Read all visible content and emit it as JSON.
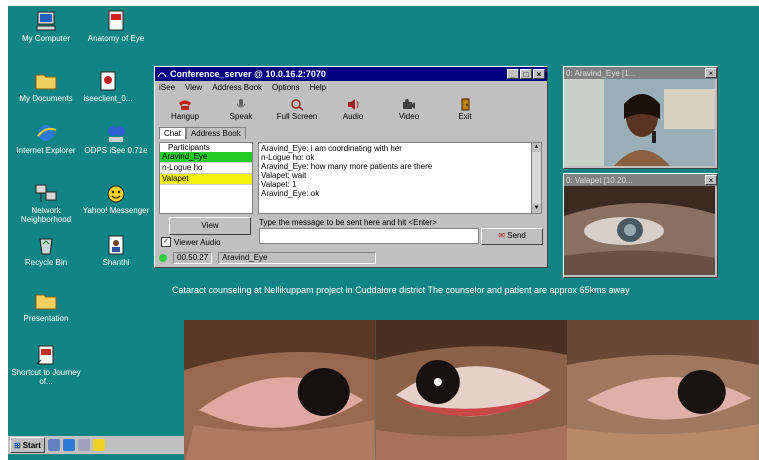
{
  "desktop_icons": [
    {
      "label": "My Computer",
      "icon": "computer-icon"
    },
    {
      "label": "Anatomy of Eye",
      "icon": "document-icon"
    },
    {
      "label": "My Documents",
      "icon": "folder-icon"
    },
    {
      "label": "iseeclient_0...",
      "icon": "program-icon"
    },
    {
      "label": "Internet Explorer",
      "icon": "internet-explorer-icon"
    },
    {
      "label": "ODPS iSee 0.71e",
      "icon": "isee-icon"
    },
    {
      "label": "Network Neighborhood",
      "icon": "network-icon"
    },
    {
      "label": "Yahoo! Messenger",
      "icon": "yahoo-messenger-icon"
    },
    {
      "label": "Recycle Bin",
      "icon": "recycle-bin-icon"
    },
    {
      "label": "Shanthi",
      "icon": "user-icon"
    },
    {
      "label": "Presentation",
      "icon": "folder-icon"
    },
    {
      "label": "Shortcut to Journey of...",
      "icon": "shortcut-icon"
    }
  ],
  "window": {
    "title": "Conference_server @ 10.0.16.2:7070",
    "menu": [
      "iSee",
      "View",
      "Address Book",
      "Options",
      "Help"
    ],
    "toolbar": [
      "Hangup",
      "Speak",
      "Full Screen",
      "Audio",
      "Video",
      "Exit"
    ],
    "tabs": [
      "Chat",
      "Address Book"
    ],
    "participants_header": "Participants",
    "participants": [
      {
        "name": "Aravind_Eye",
        "color": "#22cc22"
      },
      {
        "name": "n-Logue ho",
        "color": "#ffffff"
      },
      {
        "name": "Valapet",
        "color": "#f2f20a"
      }
    ],
    "chat_lines": [
      "Aravind_Eye: i am coordinating with her",
      "n-Logue ho: ok",
      "Aravind_Eye: how many more patients are there",
      "Valapet: wait",
      "Valapet: 1",
      "Aravind_Eye: ok"
    ],
    "view_label": "View",
    "viewer_audio_label": "Viewer Audio",
    "message_hint": "Type the message to be sent here and hit <Enter>",
    "send_label": "Send",
    "status_time": "00.50.27",
    "status_user": "Aravind_Eye"
  },
  "video_windows": [
    {
      "title": "0: Aravind_Eye [1..."
    },
    {
      "title": "0: Valapet [10.20..."
    }
  ],
  "caption": "Cataract counseling at Nellikuppam project in Cuddalore district The counselor and patient are approx 65kms away",
  "taskbar": {
    "start_label": "Start"
  }
}
